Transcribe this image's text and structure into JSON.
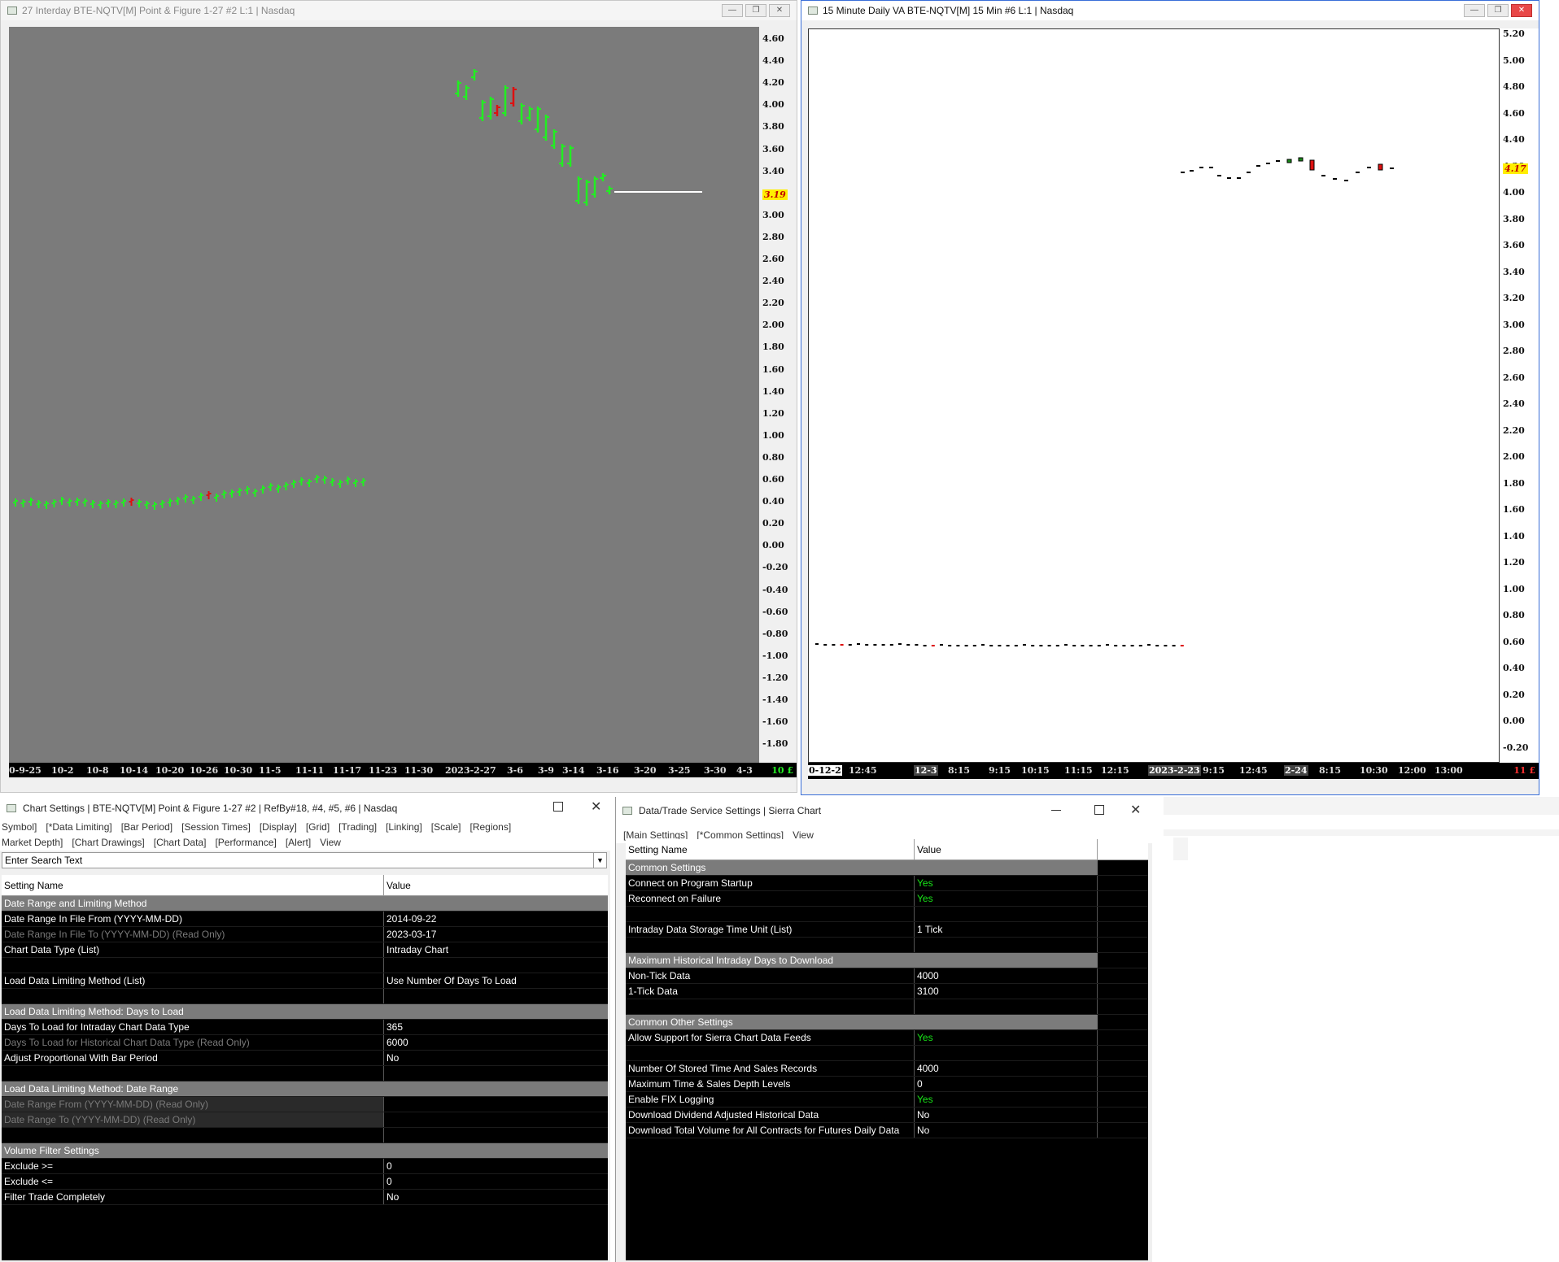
{
  "chart1": {
    "title": "27 Interday BTE-NQTV[M]  Point & Figure 1-27  #2 L:1 | Nasdaq",
    "y_labels": [
      "4.60",
      "4.40",
      "4.20",
      "4.00",
      "3.80",
      "3.60",
      "3.40",
      "3.20",
      "3.00",
      "2.80",
      "2.60",
      "2.40",
      "2.20",
      "2.00",
      "1.80",
      "1.60",
      "1.40",
      "1.20",
      "1.00",
      "0.80",
      "0.60",
      "0.40",
      "0.20",
      "0.00",
      "-0.20",
      "-0.40",
      "-0.60",
      "-0.80",
      "-1.00",
      "-1.20",
      "-1.40",
      "-1.60",
      "-1.80"
    ],
    "price_label": "3.19",
    "x_labels": [
      "0-9-25",
      "10-2",
      "10-8",
      "10-14",
      "10-20",
      "10-26",
      "10-30",
      "11-5",
      "11-11",
      "11-17",
      "11-23",
      "11-30",
      "2023-2-27",
      "3-6",
      "3-9",
      "3-14",
      "3-16",
      "3-20",
      "3-25",
      "3-30",
      "4-3"
    ],
    "corner_label": "10 £"
  },
  "chart2": {
    "title": "15 Minute Daily VA BTE-NQTV[M]  15 Min   #6 L:1 | Nasdaq",
    "y_labels": [
      "5.20",
      "5.00",
      "4.80",
      "4.60",
      "4.40",
      "4.20",
      "4.00",
      "3.80",
      "3.60",
      "3.40",
      "3.20",
      "3.00",
      "2.80",
      "2.60",
      "2.40",
      "2.20",
      "2.00",
      "1.80",
      "1.60",
      "1.40",
      "1.20",
      "1.00",
      "0.80",
      "0.60",
      "0.40",
      "0.20",
      "0.00",
      "-0.20"
    ],
    "price_label": "4.17",
    "x_labels": [
      "0-12-2",
      "12:45",
      "12-3",
      "8:15",
      "9:15",
      "10:15",
      "11:15",
      "12:15",
      "2023-2-23",
      "9:15",
      "12:45",
      "2-24",
      "8:15",
      "10:30",
      "12:00",
      "13:00"
    ],
    "corner_label": "11 £"
  },
  "chart_settings": {
    "title": "Chart Settings | BTE-NQTV[M]  Point & Figure 1-27  #2 | RefBy#18, #4, #5, #6 | Nasdaq",
    "tabs_row1": [
      "Symbol]",
      "[*Data Limiting]",
      "[Bar Period]",
      "[Session Times]",
      "[Display]",
      "[Grid]",
      "[Trading]",
      "[Linking]",
      "[Scale]",
      "[Regions]"
    ],
    "tabs_row2": [
      "Market Depth]",
      "[Chart Drawings]",
      "[Chart Data]",
      "[Performance]",
      "[Alert]",
      "View"
    ],
    "search_placeholder": "Enter Search Text",
    "col_name": "Setting Name",
    "col_value": "Value",
    "rows": [
      {
        "name": "Date Range and Limiting Method",
        "value": "",
        "kind": "section"
      },
      {
        "name": "Date Range In File From (YYYY-MM-DD)",
        "value": "2014-09-22",
        "kind": "row"
      },
      {
        "name": "Date Range In File To (YYYY-MM-DD) (Read Only)",
        "value": "2023-03-17",
        "kind": "dim"
      },
      {
        "name": "Chart Data Type (List)",
        "value": "Intraday Chart",
        "kind": "row"
      },
      {
        "name": "",
        "value": "",
        "kind": "blank"
      },
      {
        "name": "Load Data Limiting Method (List)",
        "value": "Use Number Of Days To Load",
        "kind": "row"
      },
      {
        "name": "",
        "value": "",
        "kind": "blank"
      },
      {
        "name": "Load Data Limiting Method: Days to Load",
        "value": "",
        "kind": "section"
      },
      {
        "name": "Days To Load for Intraday Chart Data Type",
        "value": "365",
        "kind": "row"
      },
      {
        "name": "Days To Load for Historical Chart Data Type (Read Only)",
        "value": "6000",
        "kind": "dim"
      },
      {
        "name": "Adjust Proportional With Bar Period",
        "value": "No",
        "kind": "row"
      },
      {
        "name": "",
        "value": "",
        "kind": "blank"
      },
      {
        "name": "Load Data Limiting Method: Date Range",
        "value": "",
        "kind": "section"
      },
      {
        "name": "Date Range From (YYYY-MM-DD) (Read Only)",
        "value": "",
        "kind": "dimgray"
      },
      {
        "name": "Date Range To (YYYY-MM-DD) (Read Only)",
        "value": "",
        "kind": "dimgray"
      },
      {
        "name": "",
        "value": "",
        "kind": "blank"
      },
      {
        "name": "Volume Filter Settings",
        "value": "",
        "kind": "section"
      },
      {
        "name": "Exclude >=",
        "value": "0",
        "kind": "row"
      },
      {
        "name": "Exclude <=",
        "value": "0",
        "kind": "row"
      },
      {
        "name": "Filter Trade Completely",
        "value": "No",
        "kind": "row"
      }
    ]
  },
  "service_settings": {
    "title": "Data/Trade Service Settings | Sierra Chart",
    "tabs": [
      "[Main Settings]",
      "[*Common Settings]",
      "View"
    ],
    "col_name": "Setting Name",
    "col_value": "Value",
    "rows": [
      {
        "name": "Common Settings",
        "value": "",
        "kind": "section"
      },
      {
        "name": "Connect on Program Startup",
        "value": "Yes",
        "kind": "yes"
      },
      {
        "name": "Reconnect on Failure",
        "value": "Yes",
        "kind": "yes"
      },
      {
        "name": "",
        "value": "",
        "kind": "blank"
      },
      {
        "name": "Intraday Data Storage Time Unit (List)",
        "value": "1 Tick",
        "kind": "row"
      },
      {
        "name": "",
        "value": "",
        "kind": "blank"
      },
      {
        "name": "Maximum Historical Intraday Days to Download",
        "value": "",
        "kind": "section"
      },
      {
        "name": "Non-Tick Data",
        "value": "4000",
        "kind": "row"
      },
      {
        "name": "1-Tick Data",
        "value": "3100",
        "kind": "row"
      },
      {
        "name": "",
        "value": "",
        "kind": "blank"
      },
      {
        "name": "Common Other Settings",
        "value": "",
        "kind": "section"
      },
      {
        "name": "Allow Support for Sierra Chart Data Feeds",
        "value": "Yes",
        "kind": "yes"
      },
      {
        "name": "",
        "value": "",
        "kind": "blank"
      },
      {
        "name": "Number Of Stored Time And Sales Records",
        "value": "4000",
        "kind": "row"
      },
      {
        "name": "Maximum Time & Sales Depth Levels",
        "value": "0",
        "kind": "row"
      },
      {
        "name": "Enable FIX Logging",
        "value": "Yes",
        "kind": "yes"
      },
      {
        "name": "Download Dividend Adjusted Historical Data",
        "value": "No",
        "kind": "row"
      },
      {
        "name": "Download Total Volume for All Contracts for Futures Daily Data",
        "value": "No",
        "kind": "row"
      }
    ]
  },
  "colors": {
    "up": "#22ee22",
    "down": "#dd1111",
    "chart1_bg": "#7b7b7b",
    "chart2_bg": "#ffffff",
    "highlight": "#ffee00"
  }
}
